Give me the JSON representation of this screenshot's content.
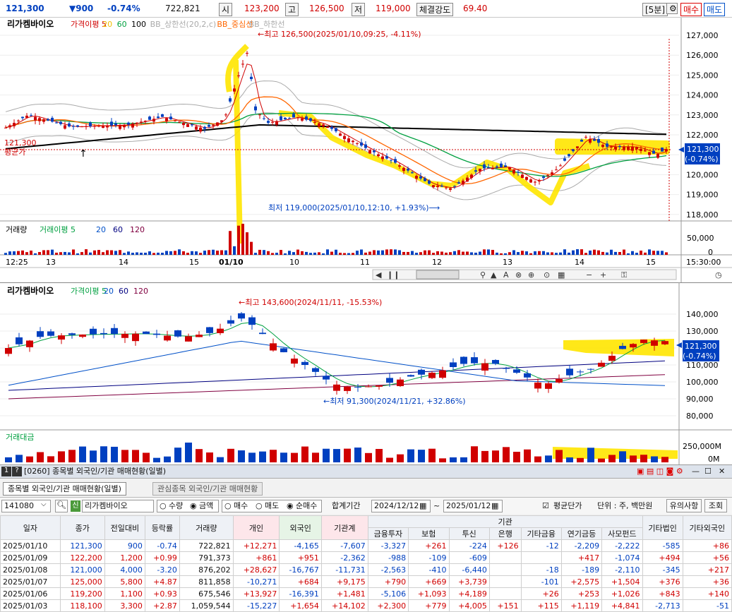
{
  "quote": {
    "price": "121,300",
    "change": "▼900",
    "pct": "-0.74%",
    "volume": "722,821",
    "open_label": "시",
    "open": "123,200",
    "high_label": "고",
    "high": "126,500",
    "low_label": "저",
    "low": "119,000",
    "strength_label": "체결강도",
    "strength": "69.40",
    "period": "[5분]",
    "buy": "매수",
    "sell": "매도"
  },
  "chart1": {
    "title": "리가켐바이오",
    "legend": [
      {
        "t": "가격이평 5",
        "c": "#d00000"
      },
      {
        "t": "20",
        "c": "#f0c000"
      },
      {
        "t": "60",
        "c": "#00a040"
      },
      {
        "t": "100",
        "c": "#000000"
      },
      {
        "t": "BB_상한선(20,2,c)",
        "c": "#aaaaaa"
      },
      {
        "t": "BB_중심선",
        "c": "#ff6600"
      },
      {
        "t": "BB_하한선",
        "c": "#aaaaaa"
      }
    ],
    "hi_note": "←최고 126,500(2025/01/10,09:25, -4.11%)",
    "lo_note": "최저 119,000(2025/01/10,12:10, +1.93%)⟶",
    "price_tag": "121,300",
    "pct_tag": "(-0.74%)",
    "left_price": "121,300",
    "left_label": "평균가",
    "yticks": [
      "127,000",
      "126,000",
      "125,000",
      "124,000",
      "123,000",
      "122,000",
      "121,000",
      "120,000",
      "119,000",
      "118,000"
    ],
    "xticks": [
      "12:25",
      "13",
      "14",
      "15",
      "01/10",
      "10",
      "11",
      "12",
      "13",
      "14",
      "15",
      "15:30:00"
    ],
    "vol_title": "거래량",
    "vol_legend": "거래이평 5",
    "vol_ticks": [
      "50,000",
      "0"
    ]
  },
  "chart2": {
    "title": "리가켐바이오",
    "legend": [
      {
        "t": "가격이평 5",
        "c": "#00a040"
      },
      {
        "t": "20",
        "c": "#0050c8"
      },
      {
        "t": "60",
        "c": "#000080"
      },
      {
        "t": "120",
        "c": "#800040"
      }
    ],
    "hi_note": "←최고 143,600(2024/11/11, -15.53%)",
    "lo_note": "←최저 91,300(2024/11/21, +32.86%)",
    "price_tag": "121,300",
    "pct_tag": "(-0.74%)",
    "yticks": [
      "140,000",
      "130,000",
      "120,000",
      "110,000",
      "100,000",
      "90,000",
      "80,000"
    ],
    "amt_title": "거래대금",
    "amt_ticks": [
      "250,000M",
      "0M"
    ]
  },
  "panel": {
    "title": "[0260] 종목별 외국인/기관 매매현황(일별)",
    "tab1": "종목별 외국인/기관 매매현황(일별)",
    "tab2": "관심종목 외국인/기관 매매현황",
    "code": "141080",
    "name": "리가켐바이오",
    "shin": "신",
    "r_qty": "수량",
    "r_amt": "금액",
    "r_buy": "매수",
    "r_sell": "매도",
    "r_net": "순매수",
    "period_label": "합계기간",
    "date_from": "2024/12/12",
    "date_to": "2025/01/12",
    "avg_label": "평균단가",
    "unit": "단위 : 주, 백만원",
    "btn_foreign": "유의사항",
    "btn_query": "조회"
  },
  "table": {
    "group_inst": "기관",
    "headers": [
      "일자",
      "종가",
      "전일대비",
      "등락률",
      "거래량",
      "개인",
      "외국인",
      "기관계",
      "금융투자",
      "보험",
      "투신",
      "은행",
      "기타금융",
      "연기금등",
      "사모펀드",
      "기타법인",
      "기타외국인"
    ],
    "rows": [
      [
        "2025/01/10",
        "121,300",
        "900",
        "-0.74",
        "722,821",
        "+12,271",
        "-4,165",
        "-7,607",
        "-3,327",
        "+261",
        "-224",
        "+126",
        "-12",
        "-2,209",
        "-2,222",
        "-585",
        "+86"
      ],
      [
        "2025/01/09",
        "122,200",
        "1,200",
        "+0.99",
        "791,373",
        "+861",
        "+951",
        "-2,362",
        "-988",
        "-109",
        "-609",
        "",
        "",
        "+417",
        "-1,074",
        "+494",
        "+56"
      ],
      [
        "2025/01/08",
        "121,000",
        "4,000",
        "-3.20",
        "876,202",
        "+28,627",
        "-16,767",
        "-11,731",
        "-2,563",
        "-410",
        "-6,440",
        "",
        "-18",
        "-189",
        "-2,110",
        "-345",
        "+217"
      ],
      [
        "2025/01/07",
        "125,000",
        "5,800",
        "+4.87",
        "811,858",
        "-10,271",
        "+684",
        "+9,175",
        "+790",
        "+669",
        "+3,739",
        "",
        "-101",
        "+2,575",
        "+1,504",
        "+376",
        "+36"
      ],
      [
        "2025/01/06",
        "119,200",
        "1,100",
        "+0.93",
        "675,546",
        "+13,927",
        "-16,391",
        "+1,481",
        "-5,106",
        "+1,093",
        "+4,189",
        "",
        "+26",
        "+253",
        "+1,026",
        "+843",
        "+140"
      ],
      [
        "2025/01/03",
        "118,100",
        "3,300",
        "+2.87",
        "1,059,544",
        "-15,227",
        "+1,654",
        "+14,102",
        "+2,300",
        "+779",
        "+4,005",
        "+151",
        "+115",
        "+1,119",
        "+4,841",
        "-2,713",
        "-51"
      ]
    ]
  },
  "colors": {
    "up": "#d00000",
    "down": "#0040c0",
    "highlight": "#ffe600"
  }
}
